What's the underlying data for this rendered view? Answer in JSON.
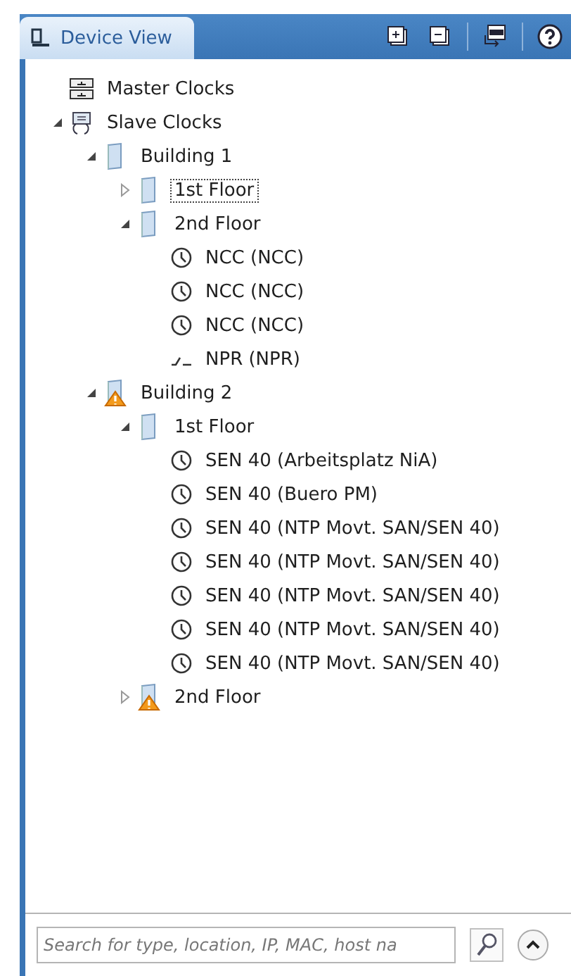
{
  "panel": {
    "tab": {
      "label": "Device View",
      "selected": true
    }
  },
  "tree": [
    {
      "kind": "master",
      "label": "Master Clocks"
    },
    {
      "kind": "slave",
      "label": "Slave Clocks",
      "expanded": true,
      "children": [
        {
          "kind": "building",
          "label": "Building 1",
          "expanded": true,
          "warning": false,
          "children": [
            {
              "kind": "floor",
              "label": "1st Floor",
              "expanded": false,
              "warning": false,
              "focused": true
            },
            {
              "kind": "floor",
              "label": "2nd Floor",
              "expanded": true,
              "warning": false,
              "focused": false,
              "children": [
                {
                  "kind": "clock",
                  "label": "NCC (NCC)"
                },
                {
                  "kind": "clock",
                  "label": "NCC (NCC)"
                },
                {
                  "kind": "clock",
                  "label": "NCC (NCC)"
                },
                {
                  "kind": "npr",
                  "label": "NPR (NPR)"
                }
              ]
            }
          ]
        },
        {
          "kind": "building",
          "label": "Building 2",
          "expanded": true,
          "warning": true,
          "children": [
            {
              "kind": "floor",
              "label": "1st Floor",
              "expanded": true,
              "warning": false,
              "focused": false,
              "children": [
                {
                  "kind": "clock",
                  "label": "SEN 40 (Arbeitsplatz NiA)"
                },
                {
                  "kind": "clock",
                  "label": "SEN 40 (Buero PM)"
                },
                {
                  "kind": "clock",
                  "label": "SEN 40 (NTP Movt. SAN/SEN 40)"
                },
                {
                  "kind": "clock",
                  "label": "SEN 40 (NTP Movt. SAN/SEN 40)"
                },
                {
                  "kind": "clock",
                  "label": "SEN 40 (NTP Movt. SAN/SEN 40)"
                },
                {
                  "kind": "clock",
                  "label": "SEN 40 (NTP Movt. SAN/SEN 40)"
                },
                {
                  "kind": "clock",
                  "label": "SEN 40 (NTP Movt. SAN/SEN 40)"
                }
              ]
            },
            {
              "kind": "floor",
              "label": "2nd Floor",
              "expanded": false,
              "warning": true,
              "focused": false
            }
          ]
        }
      ]
    }
  ],
  "search": {
    "placeholder": "Search for type, location, IP, MAC, host na"
  }
}
